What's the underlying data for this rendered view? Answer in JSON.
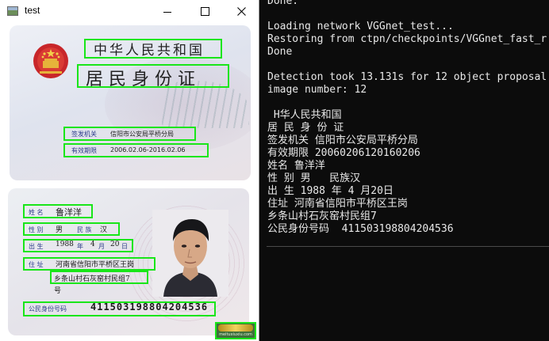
{
  "window": {
    "title": "test",
    "buttons": {
      "minimize": "minimize",
      "maximize": "maximize",
      "close": "close"
    }
  },
  "card_front": {
    "country": "中华人民共和国",
    "document": "居民身份证",
    "authority_label": "签发机关",
    "authority_value": "信阳市公安局平桥分局",
    "validity_label": "有效期限",
    "validity_value": "2006.02.06-2016.02.06"
  },
  "card_back": {
    "name_label": "姓 名",
    "name_value": "鲁洋洋",
    "sex_label": "性 别",
    "sex_value": "男",
    "ethnicity_label": "民 族",
    "ethnicity_value": "汉",
    "birth_label": "出 生",
    "birth_year": "1988",
    "birth_year_unit": "年",
    "birth_month": "4",
    "birth_month_unit": "月",
    "birth_day": "20",
    "birth_day_unit": "日",
    "address_label": "住 址",
    "address_line1": "河南省信阳市平桥区王岗",
    "address_line2": "乡条山村石灰窑村民组7",
    "address_line3": "号",
    "id_label": "公民身份号码",
    "id_value": "411503198804204536"
  },
  "watermark": {
    "url": "meituxiuxiu.com"
  },
  "console": {
    "lines": [
      "Done.",
      "",
      "Loading network VGGnet_test...",
      "Restoring from ctpn/checkpoints/VGGnet_fast_r",
      "Done",
      "",
      "Detection took 13.131s for 12 object proposal",
      "image number: 12",
      "",
      " H华人民共和国",
      "居 民 身 份 证",
      "签发机关 信阳市公安局平桥分局",
      "有效期限 20060206120160206",
      "姓名 鲁洋洋",
      "性 别 男   民族汉",
      "出 生 1988 年 4 月20日",
      "住址 河南省信阳市平桥区王岗",
      "乡条山村石灰窑村民组7",
      "公民身份号码  411503198804204536"
    ]
  },
  "colors": {
    "detection_box": "#19e619",
    "console_bg": "#0c0c0c",
    "console_text": "#e8e8e8"
  },
  "icons": [
    "app-icon",
    "minimize-icon",
    "maximize-icon",
    "close-icon",
    "national-emblem-icon"
  ]
}
